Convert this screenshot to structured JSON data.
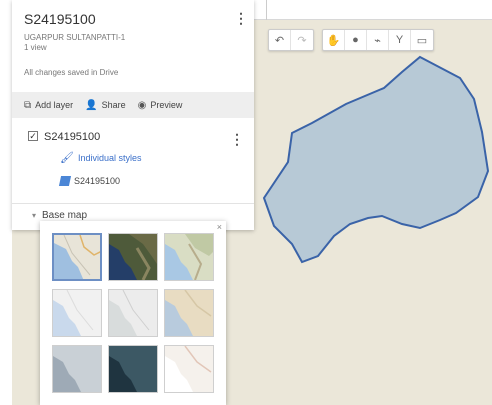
{
  "header": {
    "title": "S24195100",
    "subtitle": "UGARPUR SULTANPATTI-1",
    "views": "1 view",
    "saved_status": "All changes saved in Drive"
  },
  "actions": {
    "add_layer": "Add layer",
    "share": "Share",
    "preview": "Preview"
  },
  "layer": {
    "name": "S24195100",
    "checked": "✓",
    "styles_label": "Individual styles",
    "sublayer_name": "S24195100"
  },
  "basemap": {
    "label": "Base map",
    "close": "×",
    "thumbnails": [
      {
        "name": "map",
        "selected": true
      },
      {
        "name": "satellite",
        "selected": false
      },
      {
        "name": "terrain",
        "selected": false
      },
      {
        "name": "light-political",
        "selected": false
      },
      {
        "name": "mono-city",
        "selected": false
      },
      {
        "name": "simple-atlas",
        "selected": false
      },
      {
        "name": "light-landmass",
        "selected": false
      },
      {
        "name": "dark-landmass",
        "selected": false
      },
      {
        "name": "whitewater",
        "selected": false
      }
    ]
  },
  "toolbar": {
    "icons": [
      "undo-icon",
      "redo-icon",
      "hand-icon",
      "marker-icon",
      "draw-line-icon",
      "directions-icon",
      "ruler-icon"
    ]
  },
  "colors": {
    "polygon_fill": "#b7c9d6",
    "polygon_stroke": "#3a63a8",
    "map_bg": "#ebe7d9",
    "link_blue": "#3a6fc9"
  }
}
